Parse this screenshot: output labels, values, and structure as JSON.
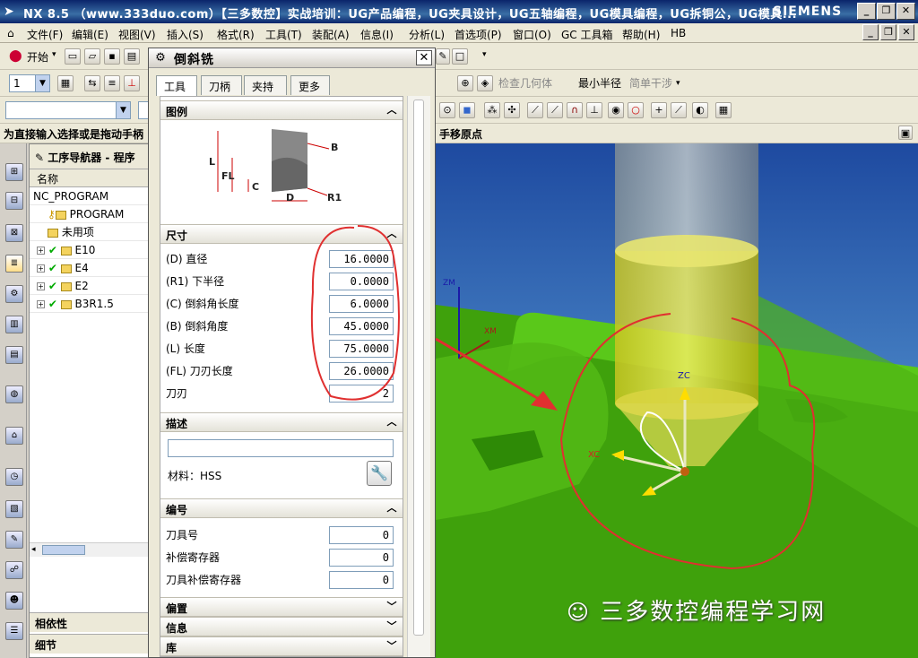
{
  "titlebar": {
    "title": "NX 8.5 （www.333duo.com）【三多数控】实战培训：UG产品编程，UG夹具设计，UG五轴编程，UG模具编程，UG拆铜公，UG模具...",
    "brand": "SIEMENS"
  },
  "menu": [
    "文件(F)",
    "编辑(E)",
    "视图(V)",
    "插入(S)",
    "格式(R)",
    "工具(T)",
    "装配(A)",
    "信息(I)",
    "分析(L)",
    "首选项(P)",
    "窗口(O)",
    "GC 工具箱",
    "帮助(H)",
    "HB"
  ],
  "toolbar": {
    "start_label": "开始",
    "layer_value": "1",
    "check_geometry": "检查几何体",
    "min_radius": "最小半径",
    "simple_interference": "简单干涉"
  },
  "statusbar": {
    "prompt": "为直接输入选择或是拖动手柄",
    "prompt_right": "手移原点"
  },
  "navigator": {
    "title": "工序导航器 - 程序",
    "column": "名称",
    "items": [
      {
        "label": "NC_PROGRAM",
        "level": 0,
        "expand": false,
        "check": false
      },
      {
        "label": "PROGRAM",
        "level": 1,
        "expand": false,
        "check": false,
        "key": true
      },
      {
        "label": "未用项",
        "level": 1,
        "expand": false,
        "check": false
      },
      {
        "label": "E10",
        "level": 1,
        "expand": true,
        "check": true
      },
      {
        "label": "E4",
        "level": 1,
        "expand": true,
        "check": true
      },
      {
        "label": "E2",
        "level": 1,
        "expand": true,
        "check": true
      },
      {
        "label": "B3R1.5",
        "level": 1,
        "expand": true,
        "check": true
      }
    ],
    "dependencies": "相依性",
    "details": "细节"
  },
  "dialog": {
    "title": "倒斜铣",
    "tabs": [
      "工具",
      "刀柄",
      "夹持器",
      "更多"
    ],
    "sections": {
      "legend": "图例",
      "dimensions": "尺寸",
      "description": "描述",
      "numbering": "编号",
      "offset": "偏置",
      "info": "信息",
      "library": "库"
    },
    "diagram": {
      "L": "L",
      "FL": "FL",
      "C": "C",
      "D": "D",
      "B": "B",
      "R1": "R1"
    },
    "fields": [
      {
        "label": "(D) 直径",
        "value": "16.0000"
      },
      {
        "label": "(R1) 下半径",
        "value": "0.0000"
      },
      {
        "label": "(C) 倒斜角长度",
        "value": "6.0000"
      },
      {
        "label": "(B) 倒斜角度",
        "value": "45.0000"
      },
      {
        "label": "(L) 长度",
        "value": "75.0000"
      },
      {
        "label": "(FL) 刀刃长度",
        "value": "26.0000"
      },
      {
        "label": "刀刃",
        "value": "2"
      }
    ],
    "material": "材料：HSS",
    "numbering_fields": [
      {
        "label": "刀具号",
        "value": "0"
      },
      {
        "label": "补偿寄存器",
        "value": "0"
      },
      {
        "label": "刀具补偿寄存器",
        "value": "0"
      }
    ]
  },
  "viewport": {
    "zm": "ZM",
    "xm": "XM",
    "zc": "ZC",
    "xc": "XC"
  },
  "watermark": "三多数控编程学习网"
}
